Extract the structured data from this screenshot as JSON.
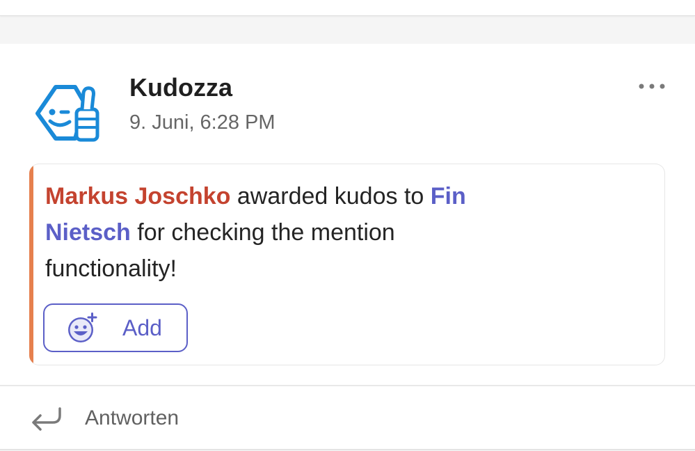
{
  "post": {
    "sender": "Kudozza",
    "timestamp": "9. Juni, 6:28 PM",
    "more_options": "•••"
  },
  "card": {
    "giver": "Markus Joschko",
    "text_part1": " awarded kudos to ",
    "receiver": "Fin Nietsch",
    "text_part2": " for checking the mention functionality!",
    "accent_color": "#e6804e",
    "giver_color": "#c4432f",
    "receiver_color": "#5b5fc7"
  },
  "reaction": {
    "add_label": "Add",
    "icon": "add-reaction-icon"
  },
  "reply": {
    "label": "Antworten",
    "icon": "reply-arrow-icon"
  },
  "avatar": {
    "icon": "kudozza-thumbs-up-logo",
    "color": "#1a8ad8"
  }
}
